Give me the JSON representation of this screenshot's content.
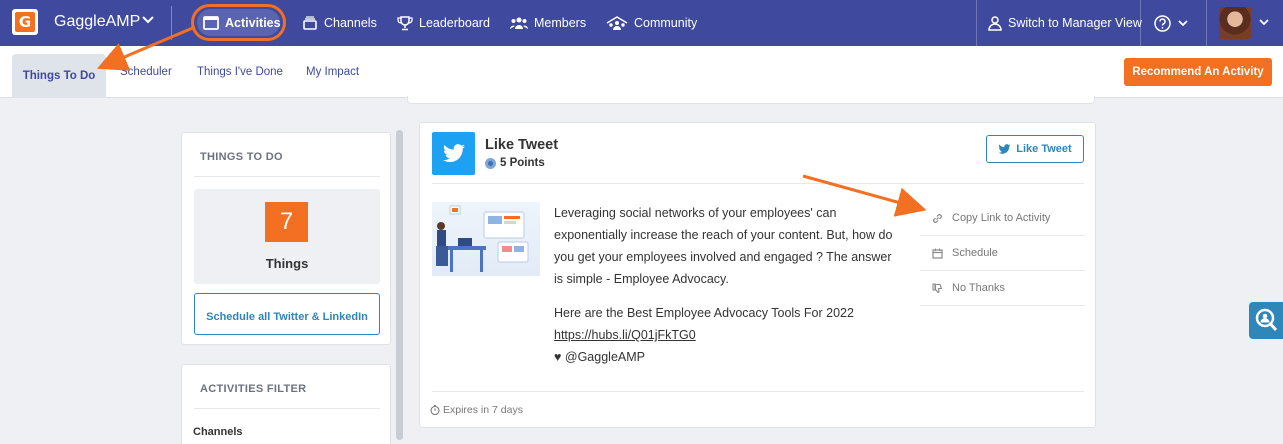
{
  "nav": {
    "brand": "GaggleAMP",
    "items": [
      {
        "label": "Activities"
      },
      {
        "label": "Channels"
      },
      {
        "label": "Leaderboard"
      },
      {
        "label": "Members"
      },
      {
        "label": "Community"
      }
    ],
    "switch_label": "Switch to Manager View"
  },
  "subnav": {
    "tabs": [
      "Things To Do",
      "Scheduler",
      "Things I've Done",
      "My Impact"
    ],
    "recommend_label": "Recommend An Activity"
  },
  "left_panel": {
    "title": "THINGS TO DO",
    "count": "7",
    "count_label": "Things",
    "schedule_label": "Schedule all Twitter & LinkedIn"
  },
  "filter_panel": {
    "title": "ACTIVITIES FILTER",
    "channels_label": "Channels"
  },
  "activity": {
    "title": "Like Tweet",
    "points": "5 Points",
    "button_label": "Like Tweet",
    "text_paragraph": "Leveraging social networks of your employees' can exponentially increase the reach of your content. But, how do you get your employees involved and engaged ? The answer is simple - Employee Advocacy.",
    "text_line": "Here are the Best Employee Advocacy Tools For 2022",
    "link": "https://hubs.li/Q01jFkTG0",
    "sign": "♥ @GaggleAMP",
    "actions": [
      "Copy Link to Activity",
      "Schedule",
      "No Thanks"
    ],
    "expires": "Expires in 7 days"
  },
  "colors": {
    "nav_bg": "#3f4a9e",
    "accent": "#f36f21",
    "link_blue": "#2e86b9",
    "twitter": "#1da1f2"
  }
}
